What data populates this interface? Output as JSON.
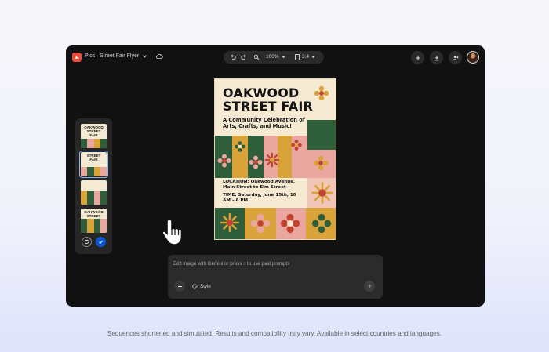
{
  "header": {
    "app_name": "Pics",
    "doc_title": "Street Fair Flyer",
    "zoom": "100%",
    "aspect_ratio": "3:4"
  },
  "icons": {
    "app_logo": "app-logo-icon",
    "title_dropdown": "chevron-down-icon",
    "cloud": "cloud-saved-icon",
    "undo": "undo-icon",
    "redo": "redo-icon",
    "zoom": "zoom-icon",
    "add": "plus-icon",
    "download": "download-icon",
    "share": "add-person-icon",
    "cursor": "hand-pointer-icon"
  },
  "poster": {
    "title": "OAKWOOD STREET FAIR",
    "subtitle": "A Community Celebration of Arts, Crafts, and Music!",
    "location": "LOCATION: Oakwood Avenue, Main Street to Elm Street",
    "time": "TIME: Saturday, June 15th, 10 AM – 6 PM"
  },
  "thumbnails": [
    {
      "title": "OAKWOOD STREET FAIR",
      "selected": false
    },
    {
      "title": "STREET FAIR",
      "selected": true
    },
    {
      "title": "",
      "selected": false
    },
    {
      "title": "OAKWOOD STREET FAIR",
      "selected": false
    }
  ],
  "prompt": {
    "placeholder": "Edit image with Gemini or press ↑ to use past prompts",
    "style_label": "Style"
  },
  "colors": {
    "accent": "#0b57d0",
    "poster_green": "#2f5e3a",
    "poster_pink": "#e9a7a0",
    "poster_mustard": "#d9a33a",
    "poster_cream": "#f6ead2"
  },
  "footer": {
    "disclaimer": "Sequences shortened and simulated. Results and compatibility may vary. Available in select countries and languages."
  }
}
